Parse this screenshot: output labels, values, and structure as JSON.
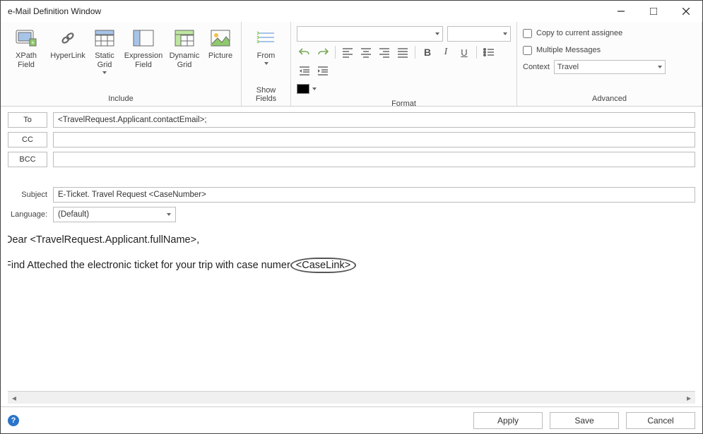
{
  "window_title": "e-Mail Definition Window",
  "ribbon": {
    "include": {
      "label": "Include",
      "items": {
        "xpath_field": "XPath\nField",
        "hyperlink": "HyperLink",
        "static_grid": "Static\nGrid",
        "expression_field": "Expression\nField",
        "dynamic_grid": "Dynamic\nGrid",
        "picture": "Picture"
      }
    },
    "show_fields": {
      "label": "Show Fields",
      "from": "From"
    },
    "format": {
      "label": "Format"
    },
    "advanced": {
      "label": "Advanced",
      "copy_to_assignee": "Copy to current assignee",
      "multiple_messages": "Multiple Messages",
      "context_label": "Context",
      "context_value": "Travel"
    }
  },
  "fields": {
    "to_label": "To",
    "to_value": "<TravelRequest.Applicant.contactEmail>;",
    "cc_label": "CC",
    "cc_value": "",
    "bcc_label": "BCC",
    "bcc_value": "",
    "subject_label": "Subject",
    "subject_value": "E-Ticket. Travel Request <CaseNumber>",
    "language_label": "Language:",
    "language_value": "(Default)"
  },
  "body": {
    "line1": "Dear <TravelRequest.Applicant.fullName>,",
    "line2_prefix": "Find Atteched the electronic ticket for your trip with case numer",
    "caselink": "<CaseLink>"
  },
  "buttons": {
    "apply": "Apply",
    "save": "Save",
    "cancel": "Cancel"
  }
}
